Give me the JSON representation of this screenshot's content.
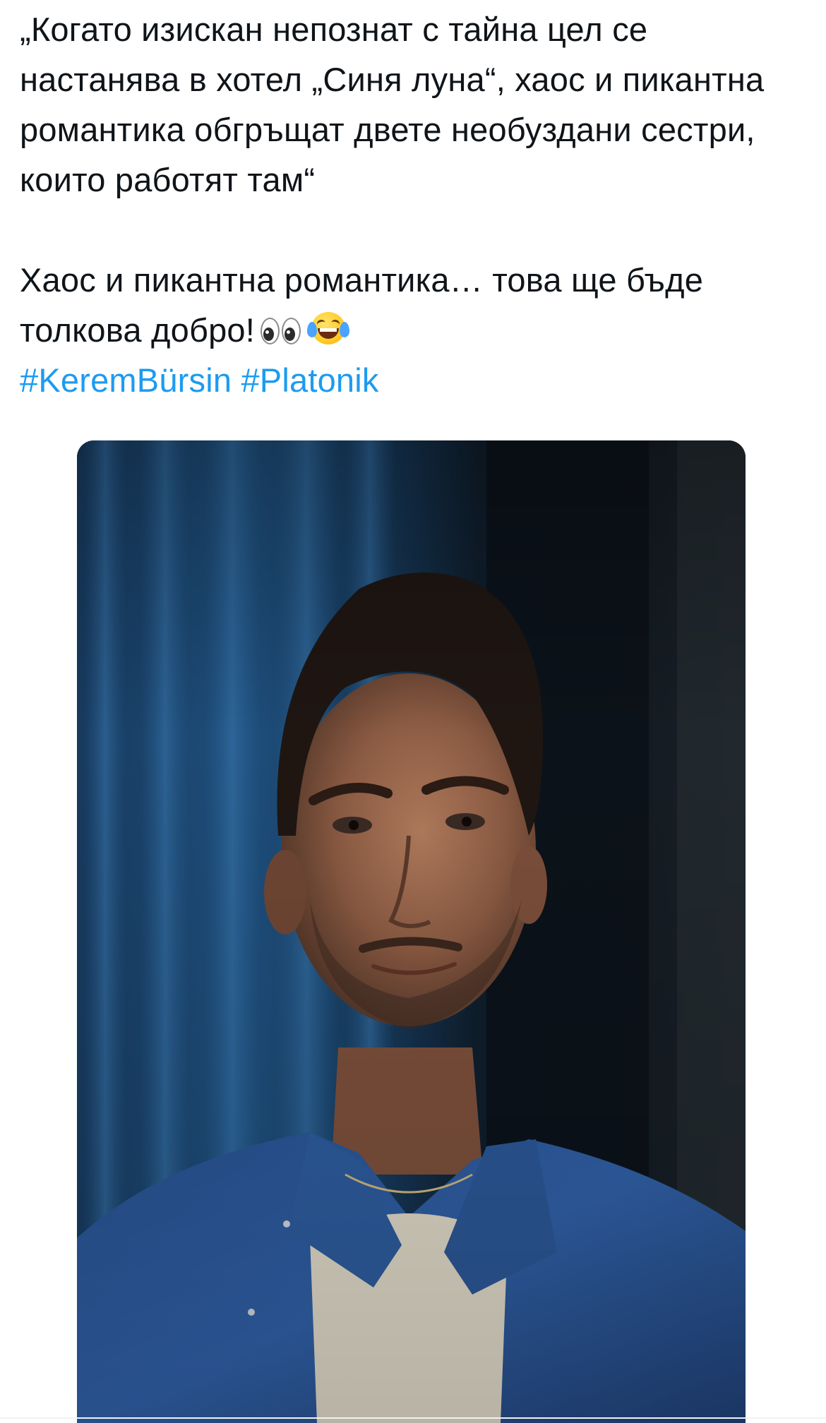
{
  "tweet": {
    "paragraph1": "„Когато изискан непознат с тайна цел се настанява в хотел „Синя луна“, хаос и пикантна романтика обгръщат двете необуздани сестри, които работят там“",
    "paragraph2": "Хаос и пикантна романтика… това ще бъде толкова добро!",
    "emojis": [
      "eyes-emoji",
      "laughing-with-tears-emoji"
    ],
    "hashtags": [
      "#KeremBürsin",
      "#Platonik"
    ],
    "colors": {
      "text": "#0f1419",
      "hashtag": "#1d9bf0"
    }
  },
  "media": {
    "type": "video-still",
    "description_icon": "photo-of-man-in-blue-shirt"
  }
}
